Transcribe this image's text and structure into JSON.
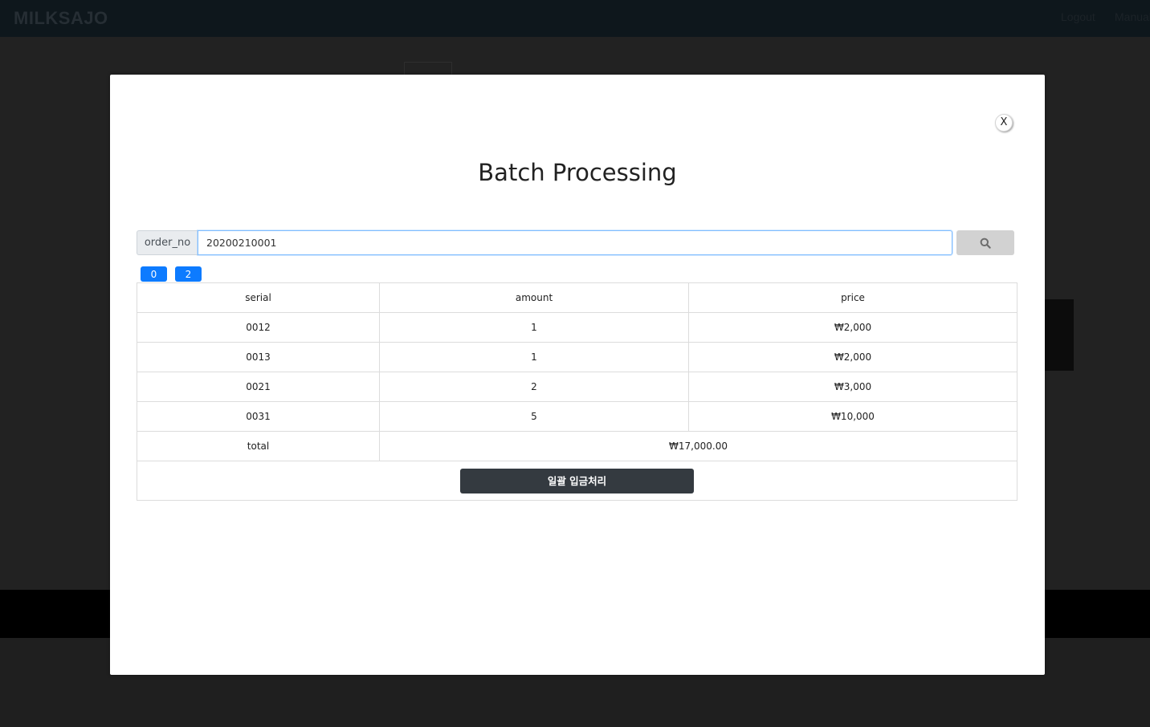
{
  "app": {
    "brand": "MILKSAJO",
    "nav": {
      "logout": "Logout",
      "manual": "Manual"
    }
  },
  "modal": {
    "close_label": "X",
    "title": "Batch Processing",
    "search": {
      "label": "order_no",
      "value": "20200210001",
      "button_icon": "search-icon"
    },
    "pages": [
      "0",
      "2"
    ],
    "table": {
      "headers": {
        "serial": "serial",
        "amount": "amount",
        "price": "price"
      },
      "rows": [
        {
          "serial": "0012",
          "amount": "1",
          "price": "₩2,000"
        },
        {
          "serial": "0013",
          "amount": "1",
          "price": "₩2,000"
        },
        {
          "serial": "0021",
          "amount": "2",
          "price": "₩3,000"
        },
        {
          "serial": "0031",
          "amount": "5",
          "price": "₩10,000"
        }
      ],
      "total_label": "total",
      "total_value": "₩17,000.00"
    },
    "batch_button_label": "일괄 입금처리"
  },
  "colors": {
    "accent_blue": "#0d7bff",
    "dark_button": "#343a40",
    "navbar_bg": "#0e171c"
  }
}
